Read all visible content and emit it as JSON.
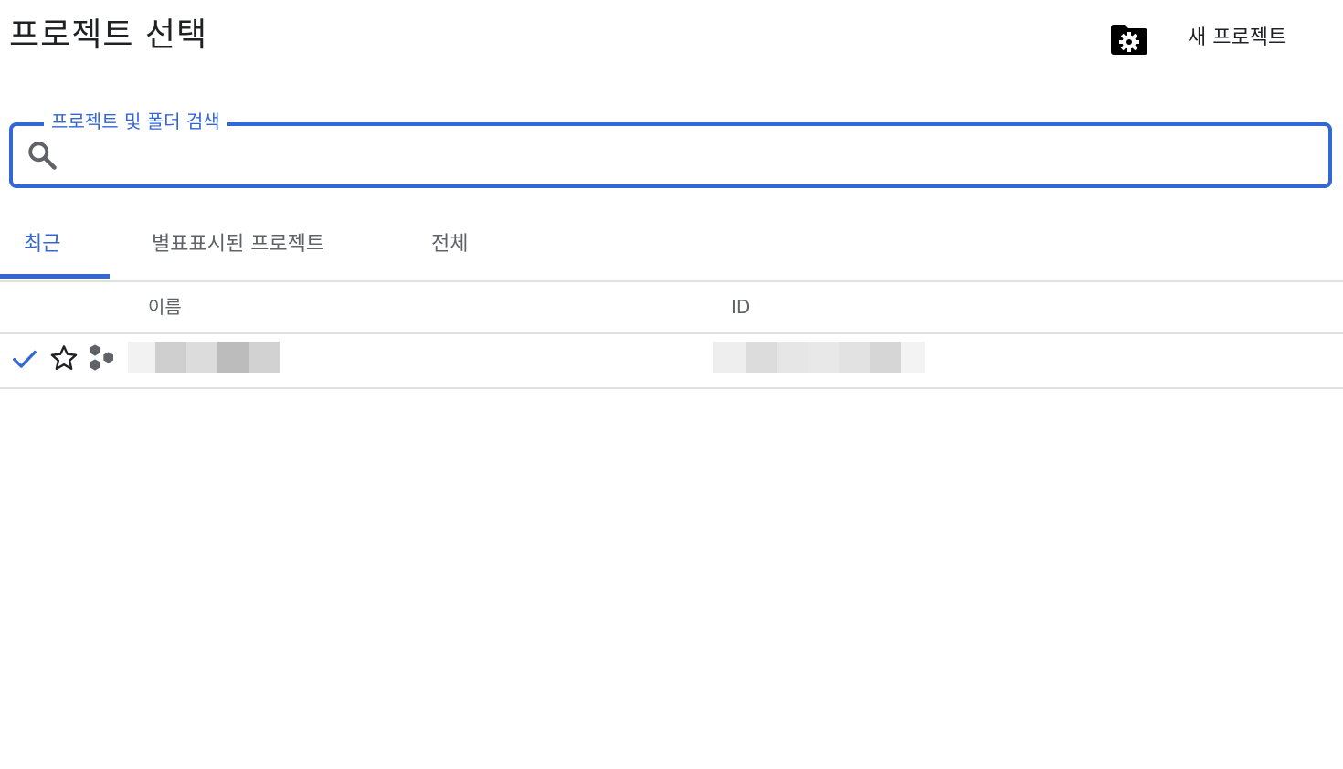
{
  "header": {
    "title": "프로젝트 선택",
    "manage_icon": "folder-gear-icon",
    "new_project_label": "새 프로젝트"
  },
  "search": {
    "label": "프로젝트 및 폴더 검색",
    "value": "",
    "placeholder": "",
    "icon": "search-icon"
  },
  "tabs": [
    {
      "label": "최근",
      "active": true
    },
    {
      "label": "별표표시된 프로젝트",
      "active": false
    },
    {
      "label": "전체",
      "active": false
    }
  ],
  "table": {
    "columns": [
      "이름",
      "ID"
    ],
    "rows": [
      {
        "selected": true,
        "starred": false,
        "type_icon": "project-hexagons-icon",
        "name": "[redacted]",
        "id": "[redacted]"
      }
    ]
  },
  "colors": {
    "accent": "#3367d6",
    "text": "#202124",
    "muted": "#5f6368",
    "divider": "#e0e0e0"
  }
}
